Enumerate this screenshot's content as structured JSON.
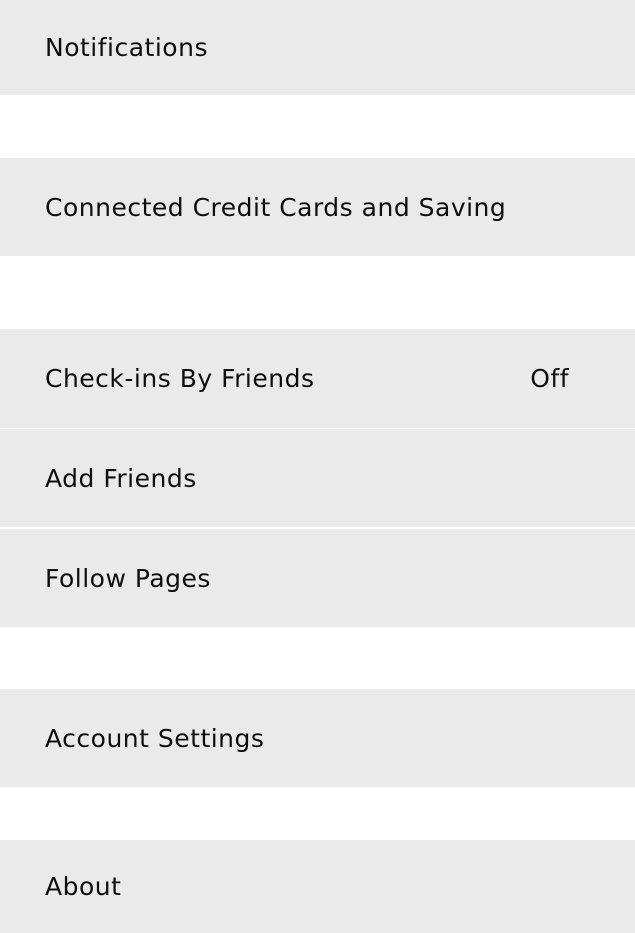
{
  "settings": {
    "notifications": {
      "label": "Notifications"
    },
    "credit_cards": {
      "label": "Connected Credit Cards and Saving"
    },
    "checkins": {
      "label": "Check-ins By Friends",
      "value": "Off"
    },
    "add_friends": {
      "label": "Add Friends"
    },
    "follow_pages": {
      "label": "Follow Pages"
    },
    "account_settings": {
      "label": "Account Settings"
    },
    "about": {
      "label": "About"
    }
  }
}
